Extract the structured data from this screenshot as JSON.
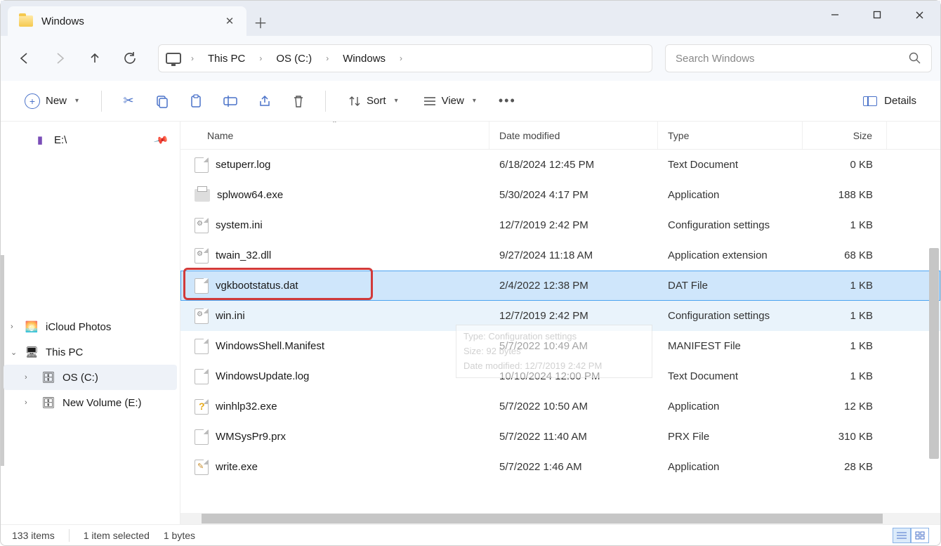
{
  "tab": {
    "title": "Windows"
  },
  "breadcrumb": [
    "This PC",
    "OS (C:)",
    "Windows"
  ],
  "search": {
    "placeholder": "Search Windows"
  },
  "toolbar": {
    "new_label": "New",
    "sort_label": "Sort",
    "view_label": "View",
    "details_label": "Details"
  },
  "sidebar": {
    "pinned": "E:\\",
    "items": [
      {
        "label": "iCloud Photos",
        "expand": "›"
      },
      {
        "label": "This PC",
        "expand": "⌄"
      }
    ],
    "subitems": [
      {
        "label": "OS (C:)",
        "selected": true
      },
      {
        "label": "New Volume (E:)"
      }
    ]
  },
  "columns": {
    "name": "Name",
    "date": "Date modified",
    "type": "Type",
    "size": "Size"
  },
  "rows": [
    {
      "name": "setuperr.log",
      "date": "6/18/2024 12:45 PM",
      "type": "Text Document",
      "size": "0 KB",
      "icon": "file"
    },
    {
      "name": "splwow64.exe",
      "date": "5/30/2024 4:17 PM",
      "type": "Application",
      "size": "188 KB",
      "icon": "printer"
    },
    {
      "name": "system.ini",
      "date": "12/7/2019 2:42 PM",
      "type": "Configuration settings",
      "size": "1 KB",
      "icon": "gear"
    },
    {
      "name": "twain_32.dll",
      "date": "9/27/2024 11:18 AM",
      "type": "Application extension",
      "size": "68 KB",
      "icon": "gear"
    },
    {
      "name": "vgkbootstatus.dat",
      "date": "2/4/2022 12:38 PM",
      "type": "DAT File",
      "size": "1 KB",
      "icon": "file",
      "selected": true,
      "highlight": true
    },
    {
      "name": "win.ini",
      "date": "12/7/2019 2:42 PM",
      "type": "Configuration settings",
      "size": "1 KB",
      "icon": "gear",
      "hover": true
    },
    {
      "name": "WindowsShell.Manifest",
      "date": "5/7/2022 10:49 AM",
      "type": "MANIFEST File",
      "size": "1 KB",
      "icon": "file"
    },
    {
      "name": "WindowsUpdate.log",
      "date": "10/10/2024 12:00 PM",
      "type": "Text Document",
      "size": "1 KB",
      "icon": "file"
    },
    {
      "name": "winhlp32.exe",
      "date": "5/7/2022 10:50 AM",
      "type": "Application",
      "size": "12 KB",
      "icon": "q"
    },
    {
      "name": "WMSysPr9.prx",
      "date": "5/7/2022 11:40 AM",
      "type": "PRX File",
      "size": "310 KB",
      "icon": "file"
    },
    {
      "name": "write.exe",
      "date": "5/7/2022 1:46 AM",
      "type": "Application",
      "size": "28 KB",
      "icon": "write"
    }
  ],
  "tooltip": {
    "l1": "Type: Configuration settings",
    "l2": "Size: 92 bytes",
    "l3": "Date modified: 12/7/2019 2:42 PM"
  },
  "status": {
    "count": "133 items",
    "selection": "1 item selected",
    "bytes": "1 bytes"
  }
}
